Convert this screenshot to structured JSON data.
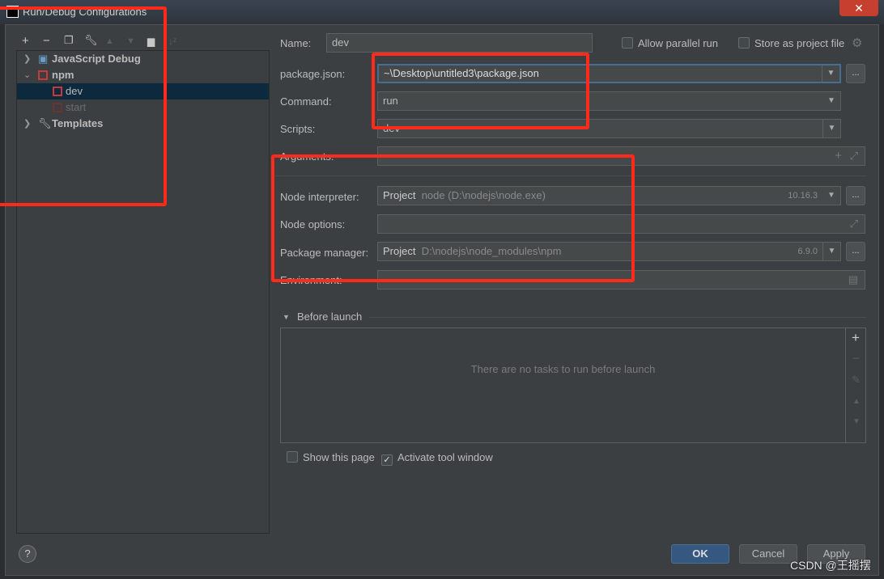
{
  "window": {
    "title": "Run/Debug Configurations",
    "close_icon": "close-icon"
  },
  "toolbar": {
    "icons": [
      "plus-icon",
      "minus-icon",
      "copy-icon",
      "wrench-icon",
      "arrow-up-icon",
      "arrow-down-icon",
      "new-folder-icon",
      "sort-icon"
    ]
  },
  "tree": {
    "items": [
      {
        "label": "JavaScript Debug",
        "level": 0,
        "expanded": false,
        "icon": "js-debug-icon"
      },
      {
        "label": "npm",
        "level": 0,
        "expanded": true,
        "icon": "npm-icon"
      },
      {
        "label": "dev",
        "level": 1,
        "selected": true,
        "icon": "npm-icon"
      },
      {
        "label": "start",
        "level": 1,
        "dimmed": true,
        "icon": "npm-icon"
      },
      {
        "label": "Templates",
        "level": 0,
        "expanded": false,
        "icon": "wrench-icon"
      }
    ]
  },
  "form": {
    "name_label": "Name:",
    "name_value": "dev",
    "allow_parallel_label": "Allow parallel run",
    "allow_parallel_checked": false,
    "store_project_label": "Store as project file",
    "store_project_checked": false,
    "package_json_label": "package.json:",
    "package_json_value": "~\\Desktop\\untitled3\\package.json",
    "command_label": "Command:",
    "command_value": "run",
    "scripts_label": "Scripts:",
    "scripts_value": "dev",
    "arguments_label": "Arguments:",
    "arguments_value": "",
    "node_interpreter_label": "Node interpreter:",
    "node_interpreter_kind": "Project",
    "node_interpreter_path": "node (D:\\nodejs\\node.exe)",
    "node_interpreter_version": "10.16.3",
    "node_options_label": "Node options:",
    "node_options_value": "",
    "package_manager_label": "Package manager:",
    "package_manager_kind": "Project",
    "package_manager_path": "D:\\nodejs\\node_modules\\npm",
    "package_manager_version": "6.9.0",
    "environment_label": "Environment:",
    "environment_value": "",
    "browse_label": "..."
  },
  "before_launch": {
    "title": "Before launch",
    "empty_text": "There are no tasks to run before launch"
  },
  "footer": {
    "show_page_label": "Show this page",
    "show_page_checked": false,
    "activate_tool_label": "Activate tool window",
    "activate_tool_checked": true,
    "help_label": "?",
    "ok_label": "OK",
    "cancel_label": "Cancel",
    "apply_label": "Apply"
  },
  "watermark": "CSDN @王摇摆",
  "colors": {
    "annotation": "#ff2a1a",
    "accent": "#365880",
    "selection": "#0d293e",
    "background": "#3c3f41"
  }
}
